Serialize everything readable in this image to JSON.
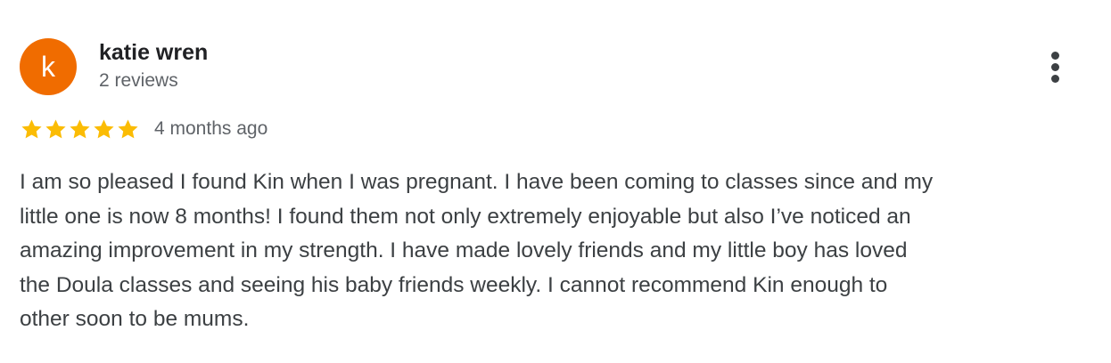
{
  "reviewer": {
    "initial": "k",
    "name": "katie wren",
    "review_count": "2 reviews",
    "avatar_color": "#f06c00"
  },
  "review": {
    "rating": 5,
    "rating_max": 5,
    "star_color": "#fbbc04",
    "date": "4 months ago",
    "text_lines": [
      "I am so pleased I found Kin when I was pregnant. I have been coming to classes since and my",
      "little one is now 8 months! I found them not only extremely enjoyable but also I’ve noticed an",
      "amazing improvement in my strength. I have made lovely friends and my little boy has loved",
      "the Doula classes and seeing his baby friends weekly. I cannot recommend Kin enough to",
      "other soon to be mums."
    ]
  },
  "menu": {
    "icon": "more-vert-icon"
  }
}
